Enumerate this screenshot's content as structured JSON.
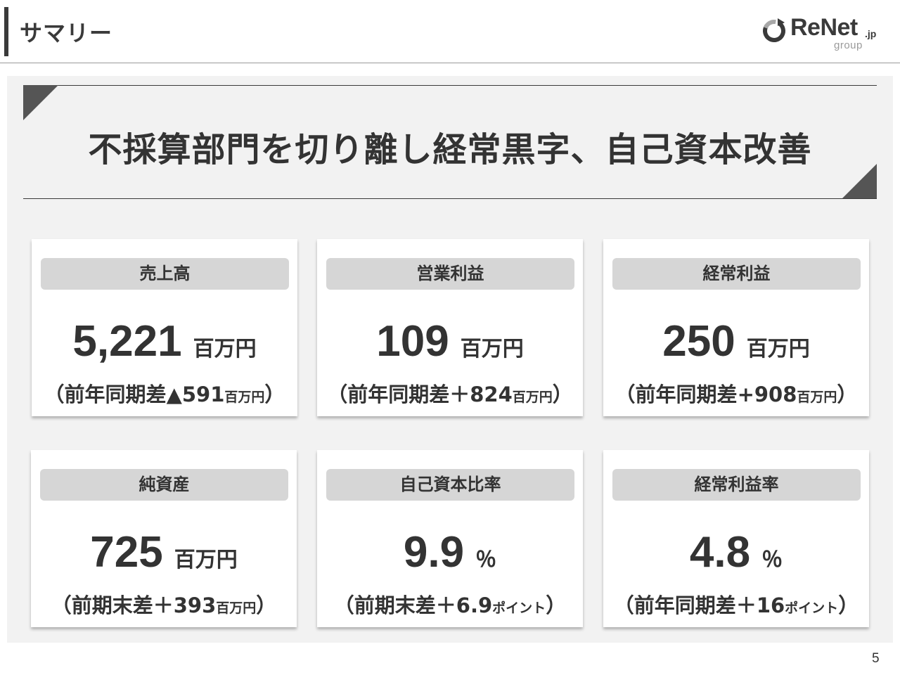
{
  "header": {
    "title": "サマリー"
  },
  "logo": {
    "name": "ReNet",
    "suffix": ".jp",
    "sub": "group"
  },
  "banner": {
    "text": "不採算部門を切り離し経常黒字、自己資本改善"
  },
  "cards": [
    {
      "label": "売上高",
      "value": "5,221",
      "unit": "百万円",
      "note_open": "（前年同期差",
      "note_delta": "▲591",
      "note_unit": "百万円",
      "note_close": "）"
    },
    {
      "label": "営業利益",
      "value": "109",
      "unit": "百万円",
      "note_open": "（前年同期差",
      "note_delta": "＋824",
      "note_unit": "百万円",
      "note_close": "）"
    },
    {
      "label": "経常利益",
      "value": "250",
      "unit": "百万円",
      "note_open": "（前年同期差",
      "note_delta": "+908",
      "note_unit": "百万円",
      "note_close": "）"
    },
    {
      "label": "純資産",
      "value": "725",
      "unit": "百万円",
      "note_open": "（前期末差",
      "note_delta": "＋393",
      "note_unit": "百万円",
      "note_close": "）"
    },
    {
      "label": "自己資本比率",
      "value": "9.9",
      "unit": "％",
      "note_open": "（前期末差",
      "note_delta": "＋6.9",
      "note_unit": "ポイント",
      "note_close": "）"
    },
    {
      "label": "経常利益率",
      "value": "4.8",
      "unit": "％",
      "note_open": "（前年同期差",
      "note_delta": "＋16",
      "note_unit": "ポイント",
      "note_close": "）"
    }
  ],
  "page_number": "5",
  "colors": {
    "accent_dark": "#3a3a3a",
    "label_bg": "#d6d6d6",
    "panel_bg": "#f2f2f2"
  }
}
